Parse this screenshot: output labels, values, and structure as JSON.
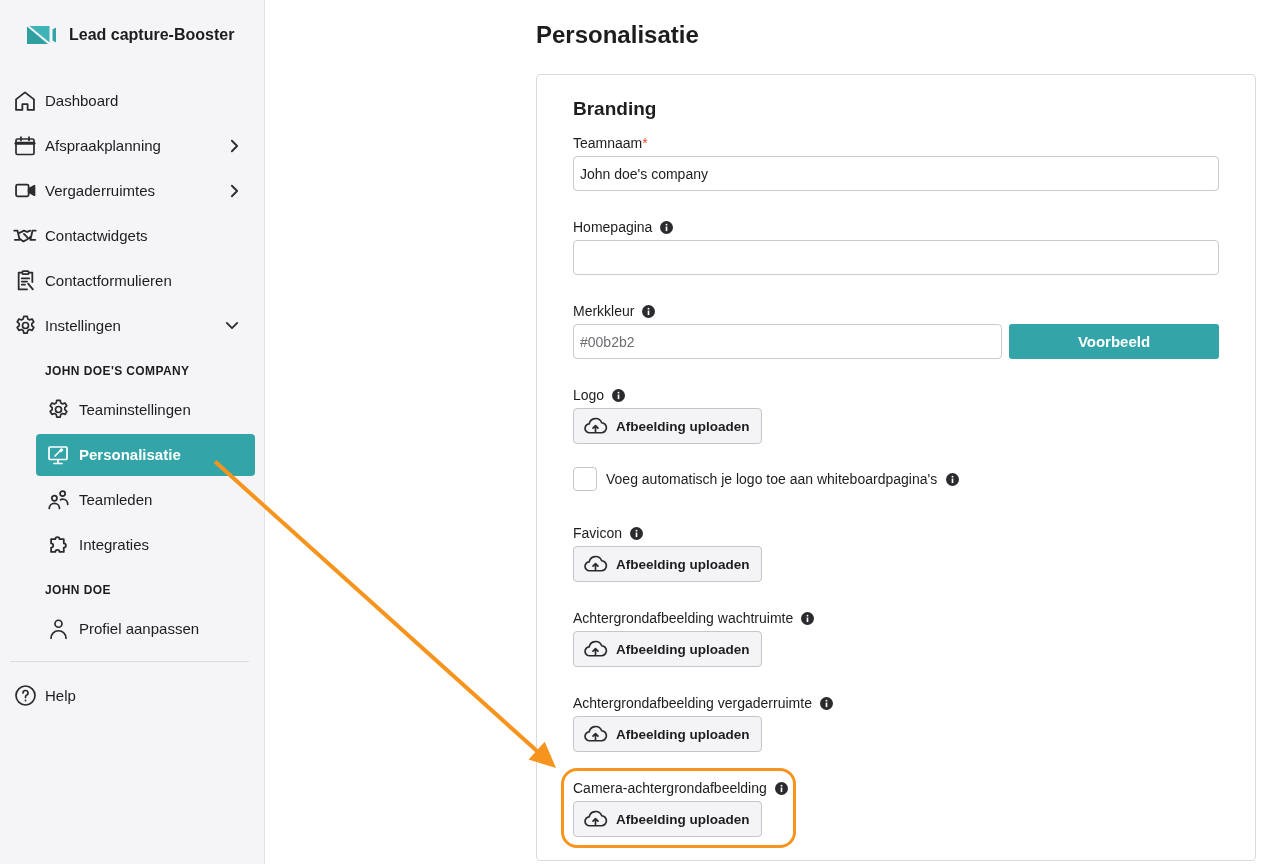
{
  "sidebar": {
    "brand": "Lead capture-Booster",
    "nav": [
      {
        "label": "Dashboard",
        "kind": "link",
        "selected": false
      },
      {
        "label": "Afspraakplanning",
        "kind": "group",
        "expanded": false,
        "selected": false
      },
      {
        "label": "Vergaderruimtes",
        "kind": "group",
        "expanded": false,
        "selected": false
      },
      {
        "label": "Contactwidgets",
        "kind": "link",
        "selected": false
      },
      {
        "label": "Contactformulieren",
        "kind": "link",
        "selected": false
      },
      {
        "label": "Instellingen",
        "kind": "group",
        "expanded": true,
        "selected": false,
        "children": [
          {
            "heading": "JOHN DOE'S COMPANY",
            "items": [
              {
                "label": "Teaminstellingen",
                "selected": false
              },
              {
                "label": "Personalisatie",
                "selected": true
              },
              {
                "label": "Teamleden",
                "selected": false
              },
              {
                "label": "Integraties",
                "selected": false
              }
            ]
          },
          {
            "heading": "JOHN DOE",
            "items": [
              {
                "label": "Profiel aanpassen",
                "selected": false
              }
            ]
          }
        ]
      }
    ],
    "footer": [
      {
        "label": "Help",
        "selected": false
      }
    ]
  },
  "page": {
    "title": "Personalisatie"
  },
  "branding": {
    "title": "Branding",
    "fields": [
      {
        "kind": "text",
        "label": "Teamnaam",
        "required_mark": "*",
        "info": false,
        "value": "John doe's company",
        "highlighted": false
      },
      {
        "kind": "text",
        "label": "Homepagina",
        "info": true,
        "highlighted": false
      },
      {
        "kind": "color",
        "label": "Merkkleur",
        "info": true,
        "placeholder": "#00b2b2",
        "button": "Voorbeeld",
        "highlighted": false
      },
      {
        "kind": "upload",
        "label": "Logo",
        "info": true,
        "button": "Afbeelding uploaden",
        "highlighted": false
      },
      {
        "kind": "checkbox",
        "label": "Voeg automatisch je logo toe aan whiteboardpagina's",
        "info": true,
        "checked": false,
        "highlighted": false
      },
      {
        "kind": "upload",
        "label": "Favicon",
        "info": true,
        "button": "Afbeelding uploaden",
        "highlighted": false
      },
      {
        "kind": "upload",
        "label": "Achtergrondafbeelding wachtruimte",
        "info": true,
        "button": "Afbeelding uploaden",
        "highlighted": false
      },
      {
        "kind": "upload",
        "label": "Achtergrondafbeelding vergaderruimte",
        "info": true,
        "button": "Afbeelding uploaden",
        "highlighted": false
      },
      {
        "kind": "upload",
        "label": "Camera-achtergrondafbeelding",
        "info": true,
        "button": "Afbeelding uploaden",
        "highlighted": true
      }
    ]
  }
}
